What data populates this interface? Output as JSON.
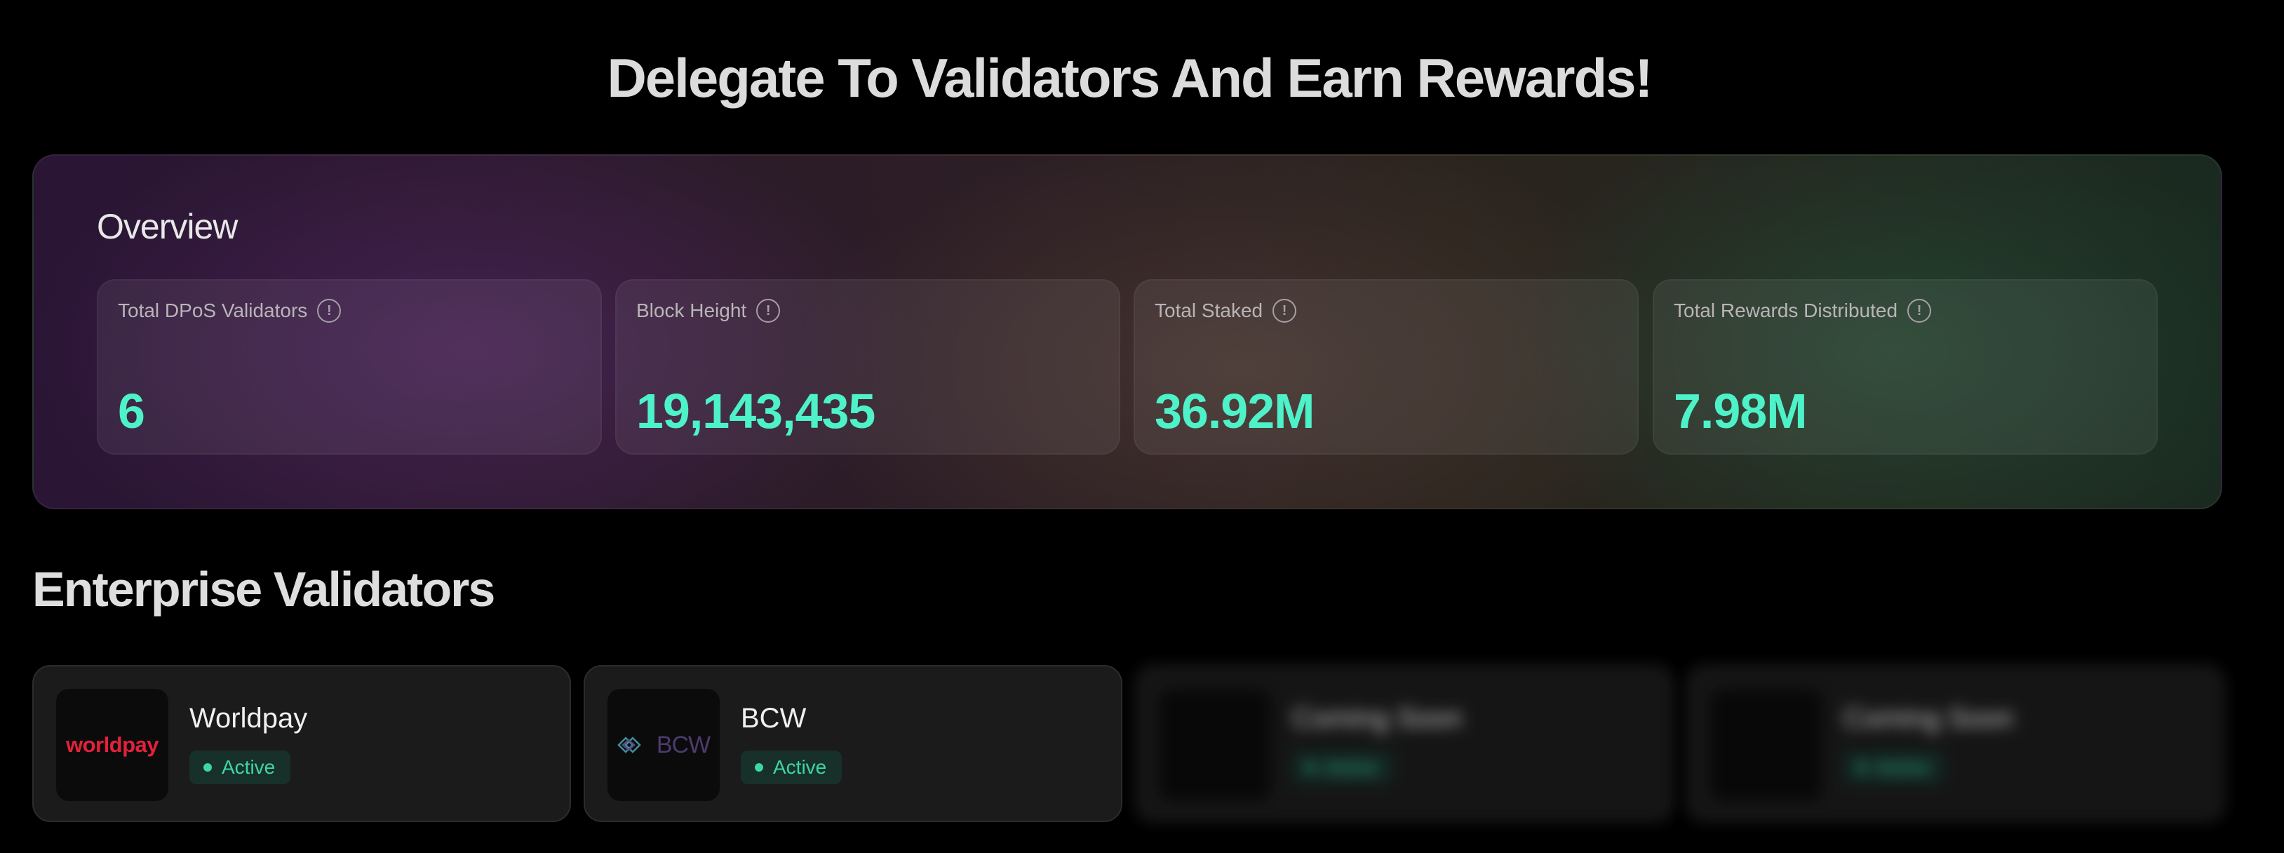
{
  "page": {
    "title": "Delegate To Validators And Earn Rewards!"
  },
  "overview": {
    "title": "Overview",
    "stats": [
      {
        "label": "Total DPoS Validators",
        "value": "6"
      },
      {
        "label": "Block Height",
        "value": "19,143,435"
      },
      {
        "label": "Total Staked",
        "value": "36.92M"
      },
      {
        "label": "Total Rewards Distributed",
        "value": "7.98M"
      }
    ]
  },
  "validators": {
    "title": "Enterprise Validators",
    "items": [
      {
        "name": "Worldpay",
        "logo_text": "worldpay",
        "status": "Active"
      },
      {
        "name": "BCW",
        "logo_text": "BCW",
        "status": "Active"
      },
      {
        "name": "Coming Soon",
        "status": "Active"
      },
      {
        "name": "Coming Soon",
        "status": "Active"
      }
    ]
  },
  "colors": {
    "accent": "#4ef2c8",
    "status_active": "#3fd5a8",
    "worldpay_red": "#e2213a"
  },
  "icons": {
    "info": "info-circle-icon"
  }
}
